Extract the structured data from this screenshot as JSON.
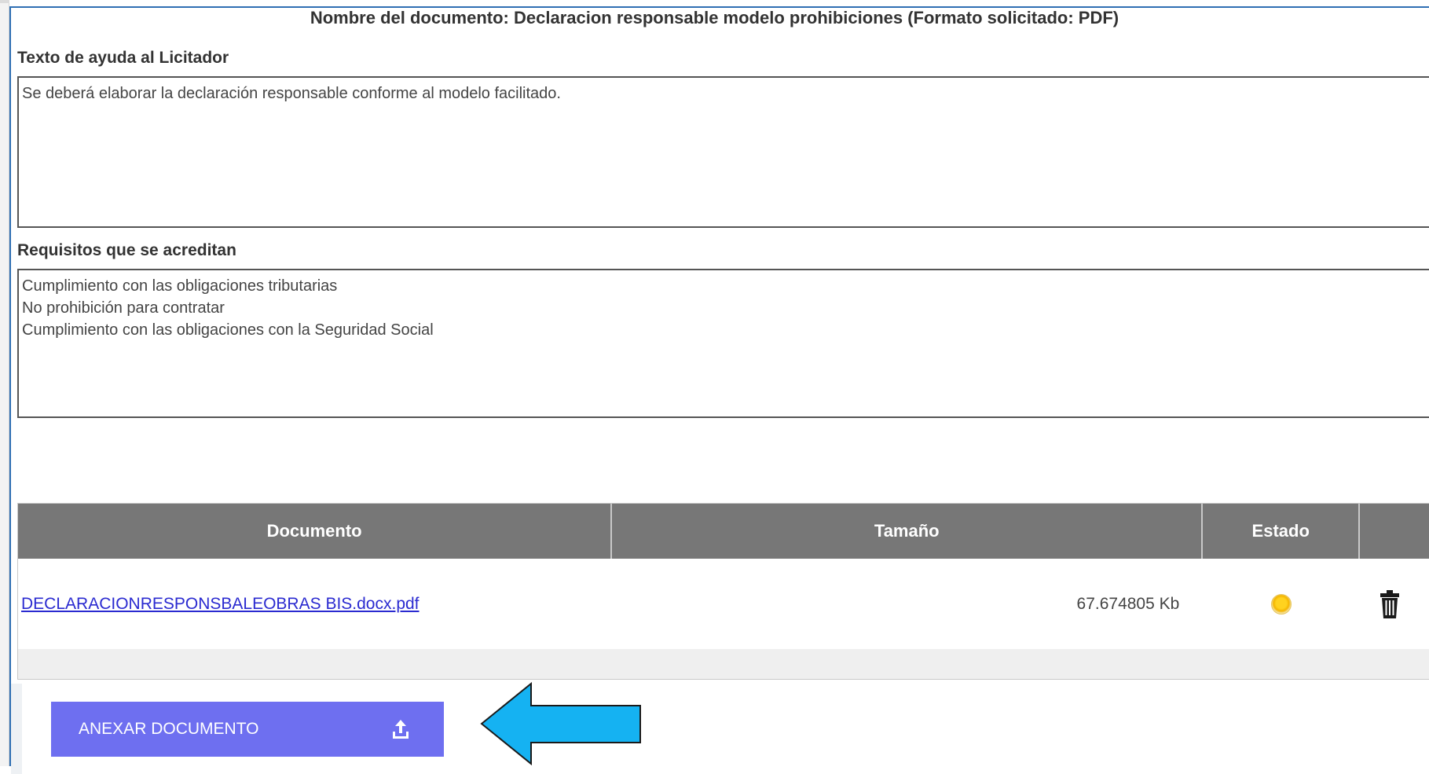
{
  "document": {
    "title": "Nombre del documento: Declaracion responsable modelo prohibiciones (Formato solicitado: PDF)"
  },
  "help": {
    "label": "Texto de ayuda al Licitador",
    "text": "Se deberá elaborar la declaración responsable conforme al modelo facilitado."
  },
  "requirements": {
    "label": "Requisitos que se acreditan",
    "text": "Cumplimiento con las obligaciones tributarias\nNo prohibición para contratar\nCumplimiento con las obligaciones con la Seguridad Social"
  },
  "table": {
    "headers": {
      "document": "Documento",
      "size": "Tamaño",
      "status": "Estado",
      "actions": ""
    },
    "rows": [
      {
        "document": "DECLARACIONRESPONSBALEOBRAS BIS.docx.pdf",
        "size": "67.674805 Kb",
        "status_icon": "yellow-circle-icon",
        "action_icon": "trash-icon"
      }
    ]
  },
  "buttons": {
    "attach": "ANEXAR DOCUMENTO",
    "attach_icon": "upload-icon"
  },
  "colors": {
    "panel_border": "#2f6fb3",
    "table_header": "#777777",
    "attach_button": "#6e6ff0",
    "link": "#2a2ad0",
    "status_yellow": "#ffd21f",
    "arrow_fill": "#15b2f2"
  },
  "annotation": {
    "arrow_icon": "left-arrow-icon"
  }
}
